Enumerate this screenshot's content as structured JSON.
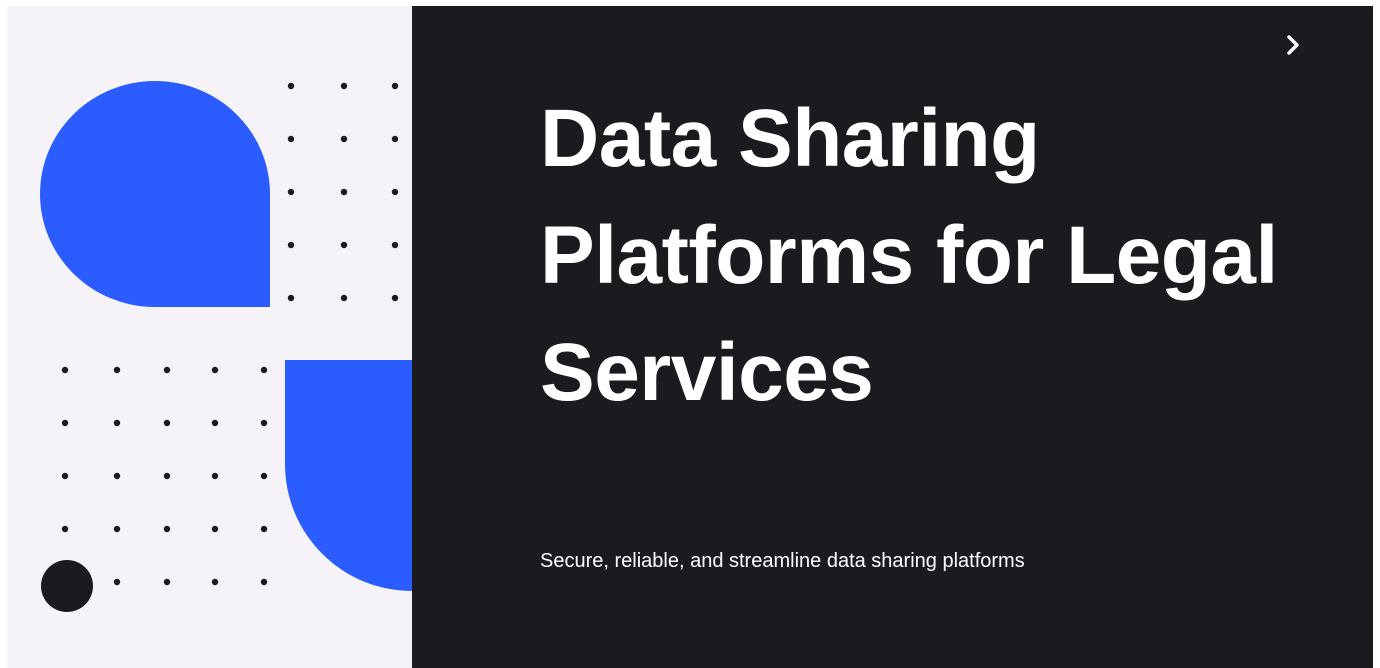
{
  "slide": {
    "title": "Data Sharing Platforms for Legal Services",
    "subtitle": "Secure, reliable, and streamline data sharing platforms"
  },
  "navigation": {
    "next_icon": "chevron-right-icon"
  },
  "colors": {
    "accent_blue": "#2b5cff",
    "dark_background": "#1b1a1e",
    "light_background": "#f5f3f8",
    "text": "#ffffff"
  }
}
